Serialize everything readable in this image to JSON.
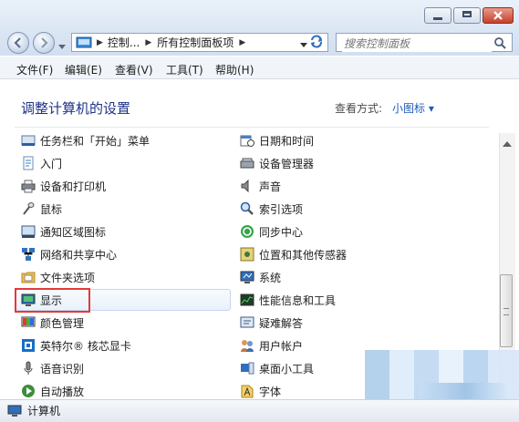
{
  "address": {
    "crumbs": [
      "控制...",
      "所有控制面板项"
    ]
  },
  "search": {
    "placeholder": "搜索控制面板"
  },
  "menu": [
    "文件(F)",
    "编辑(E)",
    "查看(V)",
    "工具(T)",
    "帮助(H)"
  ],
  "header": {
    "title": "调整计算机的设置",
    "view_label": "查看方式:",
    "view_value": "小图标 ▾"
  },
  "items_left": [
    {
      "label": "任务栏和「开始」菜单",
      "icon": "taskbar-icon"
    },
    {
      "label": "入门",
      "icon": "getting-started-icon"
    },
    {
      "label": "设备和打印机",
      "icon": "printer-icon"
    },
    {
      "label": "鼠标",
      "icon": "mouse-icon"
    },
    {
      "label": "通知区域图标",
      "icon": "notification-icon"
    },
    {
      "label": "网络和共享中心",
      "icon": "network-icon"
    },
    {
      "label": "文件夹选项",
      "icon": "folder-options-icon"
    },
    {
      "label": "显示",
      "icon": "display-icon"
    },
    {
      "label": "颜色管理",
      "icon": "color-management-icon"
    },
    {
      "label": "英特尔® 核芯显卡",
      "icon": "intel-graphics-icon"
    },
    {
      "label": "语音识别",
      "icon": "microphone-icon"
    },
    {
      "label": "自动播放",
      "icon": "autoplay-icon"
    }
  ],
  "items_right": [
    {
      "label": "日期和时间",
      "icon": "calendar-clock-icon"
    },
    {
      "label": "设备管理器",
      "icon": "device-manager-icon"
    },
    {
      "label": "声音",
      "icon": "speaker-icon"
    },
    {
      "label": "索引选项",
      "icon": "indexing-icon"
    },
    {
      "label": "同步中心",
      "icon": "sync-icon"
    },
    {
      "label": "位置和其他传感器",
      "icon": "sensor-icon"
    },
    {
      "label": "系统",
      "icon": "system-icon"
    },
    {
      "label": "性能信息和工具",
      "icon": "performance-icon"
    },
    {
      "label": "疑难解答",
      "icon": "troubleshoot-icon"
    },
    {
      "label": "用户帐户",
      "icon": "users-icon"
    },
    {
      "label": "桌面小工具",
      "icon": "gadgets-icon"
    },
    {
      "label": "字体",
      "icon": "fonts-icon"
    }
  ],
  "status": {
    "label": "计算机"
  }
}
